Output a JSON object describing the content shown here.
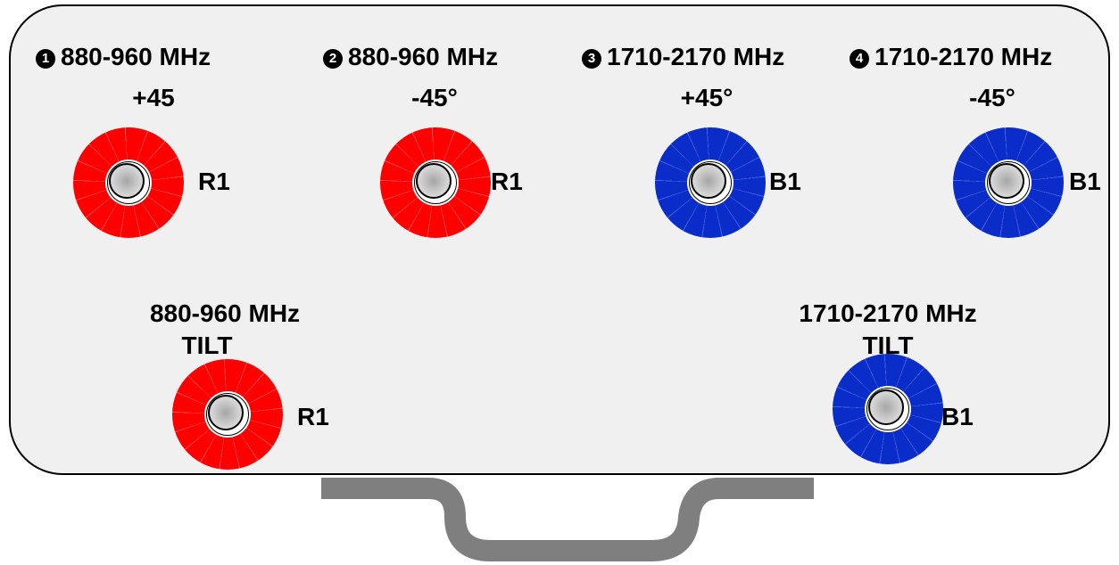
{
  "colors": {
    "red_connector": "#ff0000",
    "blue_connector": "#0a2cc8",
    "panel_fill": "#f0f0f0",
    "handle": "#7f7f7f"
  },
  "ports": [
    {
      "number": "1",
      "band": "880-960 MHz",
      "polarization": "+45",
      "connector_label": "R1",
      "color": "red"
    },
    {
      "number": "2",
      "band": "880-960 MHz",
      "polarization": "-45°",
      "connector_label": "R1",
      "color": "red"
    },
    {
      "number": "3",
      "band": "1710-2170 MHz",
      "polarization": "+45°",
      "connector_label": "B1",
      "color": "blue"
    },
    {
      "number": "4",
      "band": "1710-2170 MHz",
      "polarization": "-45°",
      "connector_label": "B1",
      "color": "blue"
    }
  ],
  "tilt_ports": [
    {
      "band": "880-960 MHz",
      "label": "TILT",
      "connector_label": "R1",
      "color": "red"
    },
    {
      "band": "1710-2170 MHz",
      "label": "TILT",
      "connector_label": "B1",
      "color": "blue"
    }
  ]
}
